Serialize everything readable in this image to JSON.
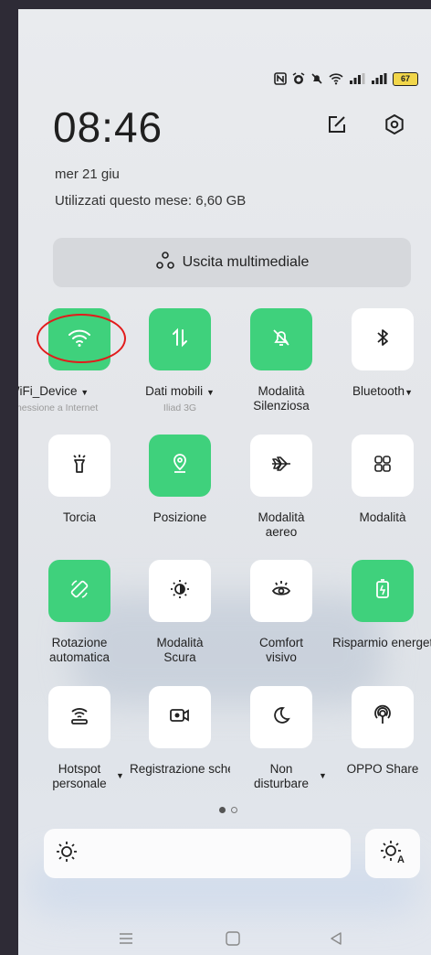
{
  "status_bar": {
    "icons": [
      "nfc-icon",
      "alarm-icon",
      "bell-off-icon",
      "wifi-icon",
      "signal-icon",
      "signal-icon"
    ],
    "battery": "67"
  },
  "header": {
    "time": "08:46",
    "date": "mer 21 giu",
    "usage": "Utilizzati questo mese: 6,60 GB"
  },
  "media_button": {
    "label": "Uscita multimediale",
    "icon": "media-output-icon"
  },
  "tiles": [
    {
      "label": "WiFi_Device",
      "sub": "Connessione a Internet",
      "icon": "wifi-icon",
      "active": true,
      "dropdown": true
    },
    {
      "label": "Dati mobili",
      "sub": "Iliad 3G",
      "icon": "mobile-data-icon",
      "active": true,
      "dropdown": true
    },
    {
      "label": "Modalità\nSilenziosa",
      "sub": "",
      "icon": "bell-off-icon",
      "active": true,
      "dropdown": false
    },
    {
      "label": "Bluetooth",
      "sub": "",
      "icon": "bluetooth-icon",
      "active": false,
      "dropdown": true
    },
    {
      "label": "Torcia",
      "sub": "",
      "icon": "flashlight-icon",
      "active": false,
      "dropdown": false
    },
    {
      "label": "Posizione",
      "sub": "",
      "icon": "location-icon",
      "active": true,
      "dropdown": false
    },
    {
      "label": "Modalità\naereo",
      "sub": "",
      "icon": "airplane-icon",
      "active": false,
      "dropdown": false
    },
    {
      "label": "Modalità",
      "sub": "",
      "icon": "grid-icon",
      "active": false,
      "dropdown": false
    },
    {
      "label": "Rotazione\nautomatica",
      "sub": "",
      "icon": "rotation-icon",
      "active": true,
      "dropdown": false
    },
    {
      "label": "Modalità\nScura",
      "sub": "",
      "icon": "dark-mode-icon",
      "active": false,
      "dropdown": false
    },
    {
      "label": "Comfort\nvisivo",
      "sub": "",
      "icon": "eye-comfort-icon",
      "active": false,
      "dropdown": false
    },
    {
      "label": "Risparmio energetico",
      "sub": "",
      "icon": "battery-saver-icon",
      "active": true,
      "dropdown": false
    },
    {
      "label": "Hotspot\npersonale",
      "sub": "",
      "icon": "hotspot-icon",
      "active": false,
      "dropdown": true
    },
    {
      "label": "Registrazione schermo",
      "sub": "",
      "icon": "screen-record-icon",
      "active": false,
      "dropdown": false
    },
    {
      "label": "Non\ndisturbare",
      "sub": "",
      "icon": "moon-icon",
      "active": false,
      "dropdown": true
    },
    {
      "label": "OPPO Share",
      "sub": "",
      "icon": "oppo-share-icon",
      "active": false,
      "dropdown": false
    }
  ],
  "page_indicator": {
    "current": 1,
    "total": 2
  },
  "brightness": {
    "icon": "sun-icon",
    "auto_icon": "auto-brightness-icon"
  },
  "colors": {
    "active": "#3fd17c",
    "annotation": "#e21b1b"
  },
  "nav": [
    "menu-icon",
    "home-icon",
    "back-icon"
  ]
}
